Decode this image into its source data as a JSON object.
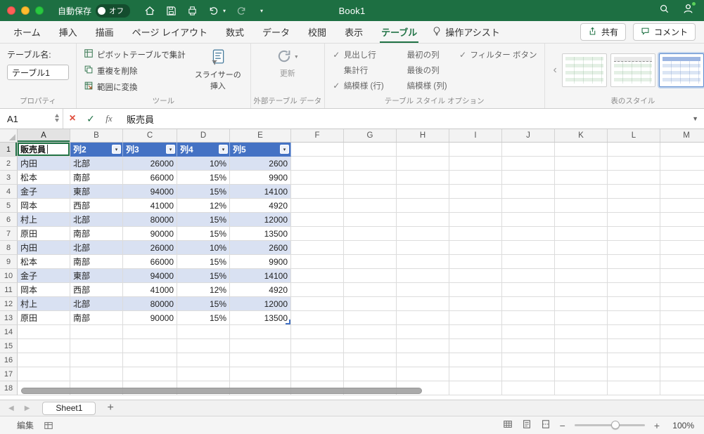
{
  "colors": {
    "titlebar_green": "#1d6f42",
    "accent_green": "#217346",
    "table_header_blue": "#4472c4",
    "banded_row_blue": "#d9e1f2"
  },
  "titlebar": {
    "autosave_label": "自動保存",
    "autosave_state": "オフ",
    "title": "Book1"
  },
  "tab_bar": {
    "tabs": [
      "ホーム",
      "挿入",
      "描画",
      "ページ レイアウト",
      "数式",
      "データ",
      "校閲",
      "表示",
      "テーブル"
    ],
    "active_tab": "テーブル",
    "assist_label": "操作アシスト",
    "share_label": "共有",
    "comment_label": "コメント"
  },
  "ribbon": {
    "properties": {
      "group_label": "プロパティ",
      "table_name_label": "テーブル名:",
      "table_name_value": "テーブル1"
    },
    "tools": {
      "group_label": "ツール",
      "items": [
        "ピボットテーブルで集計",
        "重複を削除",
        "範囲に変換"
      ],
      "slicer_label": "スライサーの挿入"
    },
    "external_data": {
      "group_label": "外部テーブル データ",
      "refresh_label": "更新"
    },
    "style_options": {
      "group_label": "テーブル スタイル オプション",
      "options": [
        {
          "name": "header-row",
          "label": "見出し行",
          "checked": true
        },
        {
          "name": "total-row",
          "label": "集計行",
          "checked": false
        },
        {
          "name": "banded-rows",
          "label": "縞模様 (行)",
          "checked": true
        },
        {
          "name": "first-column",
          "label": "最初の列",
          "checked": false
        },
        {
          "name": "last-column",
          "label": "最後の列",
          "checked": false
        },
        {
          "name": "banded-columns",
          "label": "縞模様 (列)",
          "checked": false
        },
        {
          "name": "filter-button",
          "label": "フィルター ボタン",
          "checked": true
        }
      ]
    },
    "table_styles": {
      "group_label": "表のスタイル",
      "styles": [
        {
          "name": "light-green-banded",
          "selected": false
        },
        {
          "name": "light-green-header",
          "selected": false
        },
        {
          "name": "light-blue-header",
          "selected": true
        }
      ]
    }
  },
  "formula_bar": {
    "name_box": "A1",
    "content": "販売員"
  },
  "grid": {
    "column_headers": [
      "A",
      "B",
      "C",
      "D",
      "E",
      "F",
      "G",
      "H",
      "I",
      "J",
      "K",
      "L",
      "M"
    ],
    "visible_rows": 18,
    "active_cell": "A1",
    "active_column": "A",
    "active_row": 1,
    "table": {
      "headers": [
        "販売員",
        "列2",
        "列3",
        "列4",
        "列5"
      ],
      "rows": [
        [
          "内田",
          "北部",
          "26000",
          "10%",
          "2600"
        ],
        [
          "松本",
          "南部",
          "66000",
          "15%",
          "9900"
        ],
        [
          "金子",
          "東部",
          "94000",
          "15%",
          "14100"
        ],
        [
          "岡本",
          "西部",
          "41000",
          "12%",
          "4920"
        ],
        [
          "村上",
          "北部",
          "80000",
          "15%",
          "12000"
        ],
        [
          "原田",
          "南部",
          "90000",
          "15%",
          "13500"
        ],
        [
          "内田",
          "北部",
          "26000",
          "10%",
          "2600"
        ],
        [
          "松本",
          "南部",
          "66000",
          "15%",
          "9900"
        ],
        [
          "金子",
          "東部",
          "94000",
          "15%",
          "14100"
        ],
        [
          "岡本",
          "西部",
          "41000",
          "12%",
          "4920"
        ],
        [
          "村上",
          "北部",
          "80000",
          "15%",
          "12000"
        ],
        [
          "原田",
          "南部",
          "90000",
          "15%",
          "13500"
        ]
      ]
    }
  },
  "sheet_bar": {
    "sheets": [
      "Sheet1"
    ],
    "active_sheet": "Sheet1"
  },
  "status_bar": {
    "mode_label": "編集",
    "zoom_label": "100%"
  }
}
